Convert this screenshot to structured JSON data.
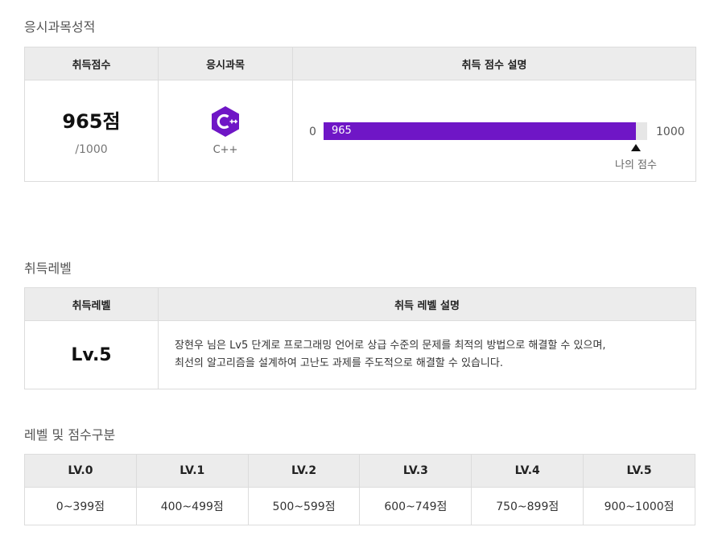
{
  "score_section": {
    "title": "응시과목성적",
    "headers": [
      "취득점수",
      "응시과목",
      "취득 점수 설명"
    ],
    "score": "965점",
    "score_total": "/1000",
    "subject": "C++",
    "subject_icon": "cpp-hexagon-icon",
    "bar": {
      "min_label": "0",
      "max_label": "1000",
      "value_label": "965",
      "value": 965,
      "max": 1000,
      "marker_label": "나의 점수",
      "fill_color": "#6f16c6",
      "track_color": "#e6e6e6"
    }
  },
  "level_section": {
    "title": "취득레벨",
    "headers": [
      "취득레벨",
      "취득 레벨 설명"
    ],
    "level": "Lv.5",
    "description_line1": "장현우 님은 Lv5 단계로 프로그래밍 언어로 상급 수준의 문제를 최적의 방법으로 해결할 수 있으며,",
    "description_line2": "최선의 알고리즘을 설계하여 고난도 과제를 주도적으로 해결할 수 있습니다."
  },
  "range_section": {
    "title": "레벨 및 점수구분",
    "levels": [
      "LV.0",
      "LV.1",
      "LV.2",
      "LV.3",
      "LV.4",
      "LV.5"
    ],
    "ranges": [
      "0~399점",
      "400~499점",
      "500~599점",
      "600~749점",
      "750~899점",
      "900~1000점"
    ]
  }
}
